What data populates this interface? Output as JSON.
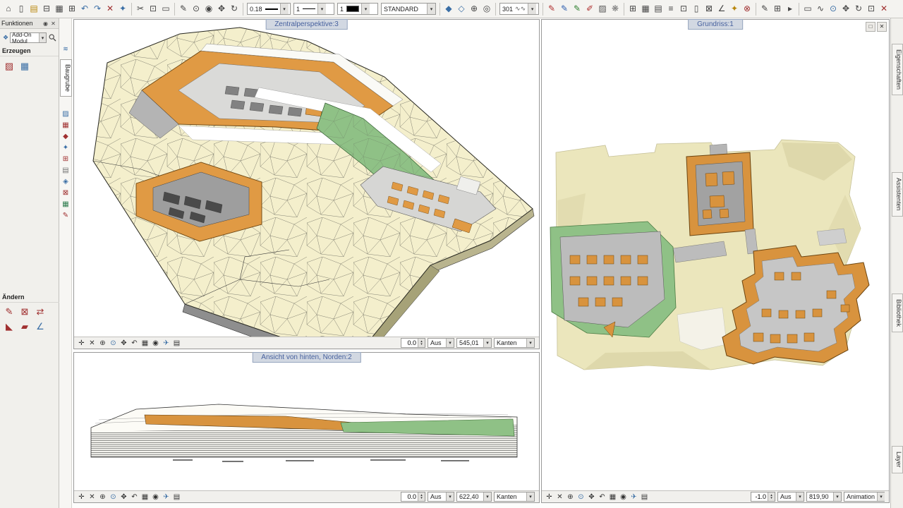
{
  "top_toolbar": {
    "pen_width": "0.18",
    "line_type": "1",
    "line_color": "1",
    "layer": "STANDARD",
    "hatch": "301",
    "groups": {
      "file": [
        {
          "name": "project-icon",
          "g": "⌂",
          "c": "#444444"
        },
        {
          "name": "new-file-icon",
          "g": "▯",
          "c": "#444444"
        },
        {
          "name": "open-file-icon",
          "g": "▤",
          "c": "#b8860b"
        },
        {
          "name": "save-icon",
          "g": "⊟",
          "c": "#444444"
        },
        {
          "name": "print-icon",
          "g": "▦",
          "c": "#444444"
        },
        {
          "name": "copy-icon",
          "g": "⊞",
          "c": "#444444"
        },
        {
          "name": "undo-icon",
          "g": "↶",
          "c": "#3a6ea5"
        },
        {
          "name": "redo-icon",
          "g": "↷",
          "c": "#3a6ea5"
        },
        {
          "name": "delete-icon",
          "g": "✕",
          "c": "#a03030"
        },
        {
          "name": "wizard-icon",
          "g": "✦",
          "c": "#3a6ea5"
        }
      ],
      "clipboard": [
        {
          "name": "cut-icon",
          "g": "✂",
          "c": "#444444"
        },
        {
          "name": "clipboard-icon",
          "g": "⊡",
          "c": "#444444"
        },
        {
          "name": "select-icon",
          "g": "▭",
          "c": "#444444"
        }
      ],
      "tools": [
        {
          "name": "draw-icon",
          "g": "✎",
          "c": "#444444"
        },
        {
          "name": "search-icon",
          "g": "⊙",
          "c": "#444444"
        },
        {
          "name": "eye-icon",
          "g": "◉",
          "c": "#444444"
        },
        {
          "name": "move-icon",
          "g": "✥",
          "c": "#444444"
        },
        {
          "name": "rotate-icon",
          "g": "↻",
          "c": "#444444"
        }
      ],
      "nav": [
        {
          "name": "prev-module-icon",
          "g": "◆",
          "c": "#3a6ea5"
        },
        {
          "name": "next-module-icon",
          "g": "◇",
          "c": "#3a6ea5"
        },
        {
          "name": "add-icon",
          "g": "⊕",
          "c": "#444444"
        },
        {
          "name": "world-icon",
          "g": "◎",
          "c": "#444444"
        }
      ],
      "pens": [
        {
          "name": "pen-red-icon",
          "g": "✎",
          "c": "#b03030"
        },
        {
          "name": "pen-blue-icon",
          "g": "✎",
          "c": "#3060b0"
        },
        {
          "name": "pen-green-icon",
          "g": "✎",
          "c": "#308030"
        },
        {
          "name": "brush-icon",
          "g": "✐",
          "c": "#b03030"
        },
        {
          "name": "hatch-fill-icon",
          "g": "▨",
          "c": "#555555"
        },
        {
          "name": "pattern-icon",
          "g": "❋",
          "c": "#777777"
        }
      ],
      "modules": [
        {
          "name": "grid-icon",
          "g": "⊞",
          "c": "#444444"
        },
        {
          "name": "table-icon",
          "g": "▦",
          "c": "#444444"
        },
        {
          "name": "list-icon",
          "g": "▤",
          "c": "#444444"
        },
        {
          "name": "layers-icon",
          "g": "≡",
          "c": "#444444"
        },
        {
          "name": "reference-icon",
          "g": "⊡",
          "c": "#444444"
        },
        {
          "name": "document-icon",
          "g": "▯",
          "c": "#444444"
        },
        {
          "name": "lock-icon",
          "g": "⊠",
          "c": "#444444"
        },
        {
          "name": "measure-icon",
          "g": "∠",
          "c": "#444444"
        },
        {
          "name": "star-icon",
          "g": "✦",
          "c": "#b8860b"
        },
        {
          "name": "cancel-icon",
          "g": "⊗",
          "c": "#a03030"
        }
      ],
      "draw2": [
        {
          "name": "edit-icon",
          "g": "✎",
          "c": "#444444"
        },
        {
          "name": "insert-icon",
          "g": "⊞",
          "c": "#444444"
        },
        {
          "name": "expand-icon",
          "g": "▸",
          "c": "#444444"
        }
      ],
      "view": [
        {
          "name": "selection-box-icon",
          "g": "▭",
          "c": "#444444"
        },
        {
          "name": "freehand-icon",
          "g": "∿",
          "c": "#444444"
        },
        {
          "name": "zoom-icon",
          "g": "⊙",
          "c": "#3a6ea5"
        },
        {
          "name": "pan-icon",
          "g": "✥",
          "c": "#444444"
        },
        {
          "name": "refresh-view-icon",
          "g": "↻",
          "c": "#444444"
        },
        {
          "name": "fit-view-icon",
          "g": "⊡",
          "c": "#444444"
        },
        {
          "name": "close-red-icon",
          "g": "✕",
          "c": "#a03030"
        }
      ]
    }
  },
  "left_panel": {
    "title": "Funktionen",
    "addon_label": "Add-On Modul",
    "create_label": "Erzeugen",
    "modify_label": "Ändern",
    "create_icons": [
      {
        "name": "dtm-mesh-icon",
        "g": "▨",
        "c": "#a03030"
      },
      {
        "name": "dtm-surface-icon",
        "g": "▦",
        "c": "#3a6ea5"
      }
    ],
    "modify_icons": [
      {
        "name": "modify-mesh-icon",
        "g": "✎",
        "c": "#a03030"
      },
      {
        "name": "delete-mesh-icon",
        "g": "⊠",
        "c": "#a03030"
      },
      {
        "name": "swap-edge-icon",
        "g": "⇄",
        "c": "#a03030"
      },
      {
        "name": "section-lines-icon",
        "g": "◣",
        "c": "#a03030"
      },
      {
        "name": "erase-dtm-icon",
        "g": "▰",
        "c": "#a03030"
      },
      {
        "name": "slope-45-icon",
        "g": "∠",
        "c": "#3a6ea5"
      }
    ]
  },
  "left_strip": {
    "top_icon_glyph": "≋",
    "tab": "Baugrube",
    "icons": [
      {
        "name": "terrain-icon",
        "g": "▨",
        "c": "#3a6ea5"
      },
      {
        "name": "mesh-icon",
        "g": "▦",
        "c": "#a03030"
      },
      {
        "name": "point-icon",
        "g": "◆",
        "c": "#a03030"
      },
      {
        "name": "star-tool-icon",
        "g": "✦",
        "c": "#3a6ea5"
      },
      {
        "name": "grid-tool-icon",
        "g": "⊞",
        "c": "#a03030"
      },
      {
        "name": "rows-icon",
        "g": "▤",
        "c": "#777777"
      },
      {
        "name": "diamond-icon",
        "g": "◈",
        "c": "#3a6ea5"
      },
      {
        "name": "box-x-icon",
        "g": "⊠",
        "c": "#a03030"
      },
      {
        "name": "green-grid-icon",
        "g": "▦",
        "c": "#2f7d4f"
      },
      {
        "name": "pen-tool-icon",
        "g": "✎",
        "c": "#a03030"
      }
    ]
  },
  "right_strip": {
    "tabs": [
      {
        "name": "tab-eigenschaften",
        "label": "Eigenschaften"
      },
      {
        "name": "tab-assistenten",
        "label": "Assistenten"
      },
      {
        "name": "tab-bibliothek",
        "label": "Bibliothek"
      },
      {
        "name": "tab-layer",
        "label": "Layer"
      }
    ]
  },
  "viewport_tools": [
    {
      "name": "track-icon",
      "g": "✛",
      "c": "#333333"
    },
    {
      "name": "close-view-icon",
      "g": "✕",
      "c": "#333333"
    },
    {
      "name": "zoom-in-icon",
      "g": "⊕",
      "c": "#333333"
    },
    {
      "name": "zoom-section-icon",
      "g": "⊙",
      "c": "#3a6ea5"
    },
    {
      "name": "pan-view-icon",
      "g": "✥",
      "c": "#333333"
    },
    {
      "name": "previous-view-icon",
      "g": "↶",
      "c": "#333333"
    },
    {
      "name": "print-view-icon",
      "g": "▦",
      "c": "#333333"
    },
    {
      "name": "camera-icon",
      "g": "◉",
      "c": "#333333"
    },
    {
      "name": "fly-mode-icon",
      "g": "✈",
      "c": "#3a6ea5"
    },
    {
      "name": "view-list-icon",
      "g": "▤",
      "c": "#333333"
    }
  ],
  "window_buttons": [
    {
      "name": "restore-icon",
      "g": "□"
    },
    {
      "name": "close-window-icon",
      "g": "✕"
    }
  ],
  "viewports": {
    "persp": {
      "title": "Zentralperspektive:3",
      "scale": "0.0",
      "layer_state": "Aus",
      "elevation": "545,01",
      "display": "Kanten"
    },
    "back": {
      "title": "Ansicht von hinten, Norden:2",
      "scale": "0.0",
      "layer_state": "Aus",
      "elevation": "622,40",
      "display": "Kanten"
    },
    "plan": {
      "title": "Grundriss:1",
      "scale": "-1.0",
      "layer_state": "Aus",
      "elevation": "819,90",
      "display": "Animation"
    }
  },
  "colors": {
    "terrain": "#f4efcc",
    "excavation_orange": "#e09a44",
    "slope_green": "#8fc186",
    "building_gray": "#bcbcbc",
    "accent_blue": "#47619e"
  }
}
